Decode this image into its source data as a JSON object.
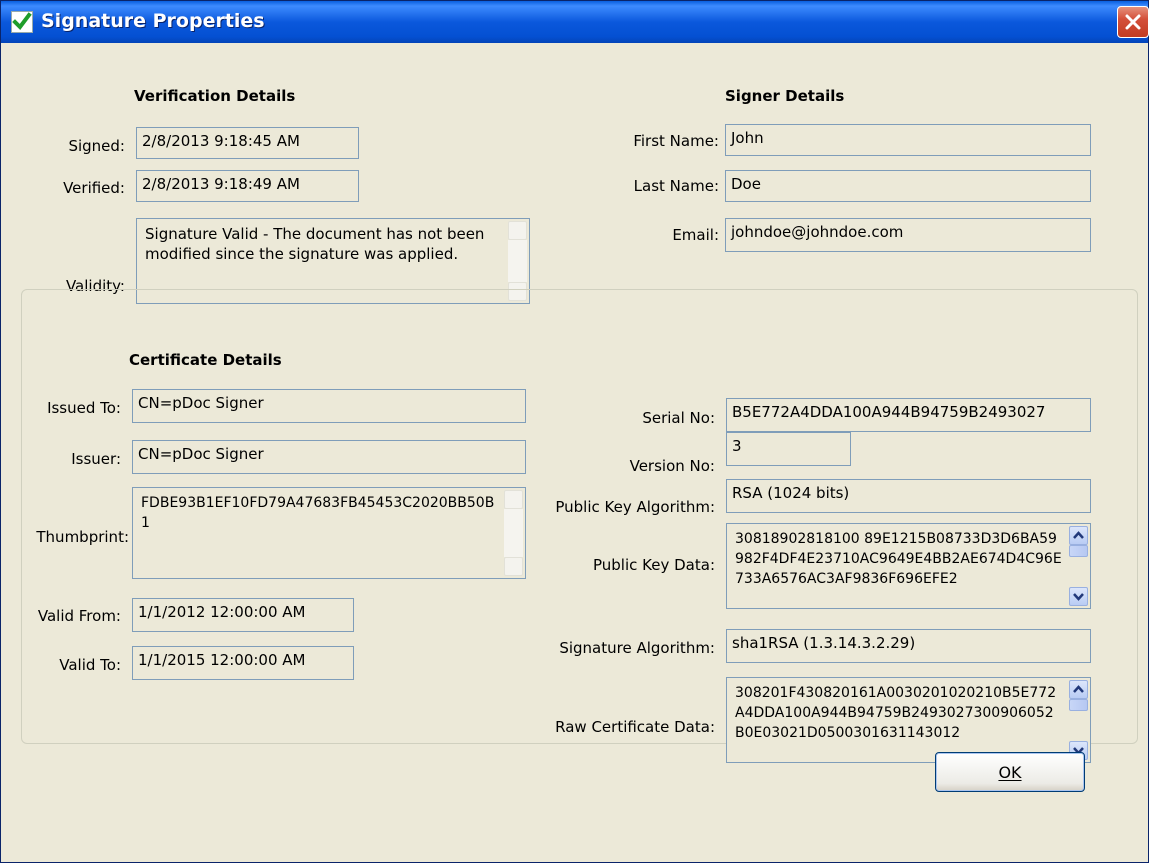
{
  "window": {
    "title": "Signature Properties"
  },
  "verification": {
    "header": "Verification Details",
    "signed_label": "Signed:",
    "signed_value": "2/8/2013 9:18:45 AM",
    "verified_label": "Verified:",
    "verified_value": "2/8/2013 9:18:49 AM",
    "validity_label": "Validity:",
    "validity_value": "Signature Valid - The document has not been modified since the signature was applied."
  },
  "signer": {
    "header": "Signer Details",
    "first_name_label": "First Name:",
    "first_name_value": "John",
    "last_name_label": "Last Name:",
    "last_name_value": "Doe",
    "email_label": "Email:",
    "email_value": "johndoe@johndoe.com"
  },
  "certificate": {
    "header": "Certificate Details",
    "issued_to_label": "Issued To:",
    "issued_to_value": "CN=pDoc Signer",
    "issuer_label": "Issuer:",
    "issuer_value": "CN=pDoc Signer",
    "thumbprint_label": "Thumbprint:",
    "thumbprint_value": "FDBE93B1EF10FD79A47683FB45453C2020BB50B1",
    "valid_from_label": "Valid From:",
    "valid_from_value": "1/1/2012 12:00:00 AM",
    "valid_to_label": "Valid To:",
    "valid_to_value": "1/1/2015 12:00:00 AM",
    "serial_label": "Serial No:",
    "serial_value": "B5E772A4DDA100A944B94759B2493027",
    "version_label": "Version No:",
    "version_value": "3",
    "pk_algorithm_label": "Public Key Algorithm:",
    "pk_algorithm_value": "RSA (1024 bits)",
    "pk_data_label": "Public Key Data:",
    "pk_data_value": "30818902818100 89E1215B08733D3D6BA59982F4DF4E23710AC9649E4BB2AE674D4C96E733A6576AC3AF9836F696EFE2",
    "sig_algorithm_label": "Signature Algorithm:",
    "sig_algorithm_value": "sha1RSA (1.3.14.3.2.29)",
    "raw_label": "Raw Certificate Data:",
    "raw_value": "308201F430820161A0030201020210B5E772A4DDA100A944B94759B2493027300906052B0E03021D0500301631143012"
  },
  "buttons": {
    "ok_label": "OK"
  },
  "colors": {
    "titlebar": "#0a5fe0",
    "dialog_bg": "#ece9d8",
    "field_border": "#7f9db9"
  },
  "icons": {
    "title": "green-check-icon",
    "close": "close-x-icon"
  }
}
